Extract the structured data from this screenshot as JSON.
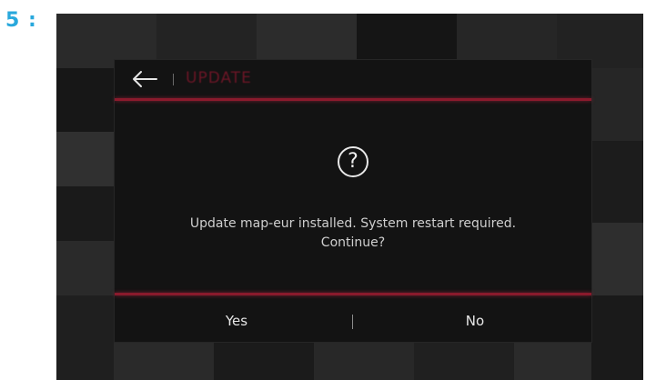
{
  "step": {
    "label": "5 :"
  },
  "header": {
    "back_icon": "arrow-left-icon",
    "title": "UPDATE"
  },
  "dialog": {
    "icon": "question-circle-icon",
    "icon_glyph": "?",
    "message_line1": "Update map-eur installed. System restart required.",
    "message_line2": "Continue?"
  },
  "buttons": {
    "yes": "Yes",
    "no": "No"
  },
  "colors": {
    "accent_line": "#8a1a2c",
    "title": "#6b1626",
    "step_label": "#29a8dc",
    "background": "#131313"
  }
}
